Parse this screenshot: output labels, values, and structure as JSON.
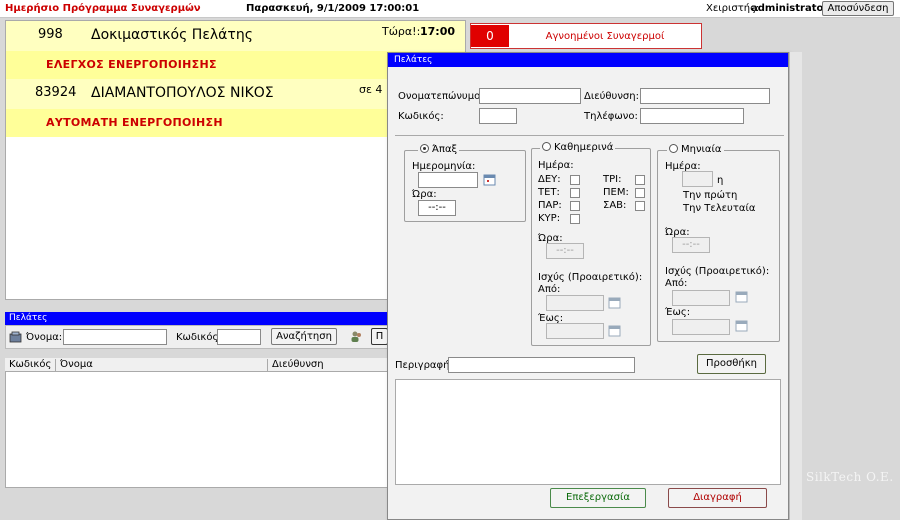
{
  "header": {
    "app_title": "Ημερήσιο Πρόγραμμα Συναγερμών",
    "datetime": "Παρασκευή, 9/1/2009 17:00:01",
    "user_label": "Χειριστής:",
    "user_name": "administrator",
    "logout_label": "Αποσύνδεση"
  },
  "alarms": [
    {
      "code": "998",
      "name": "Δοκιμαστικός Πελάτης",
      "time_label": "Τώρα!:",
      "time_value": "17:00",
      "status": "ΕΛΕΓΧΟΣ ΕΝΕΡΓΟΠΟΙΗΣΗΣ"
    },
    {
      "code": "83924",
      "name": "ΔΙΑΜΑΝΤΟΠΟΥΛΟΣ ΝΙΚΟΣ",
      "time_label": "σε 4",
      "status": "ΑΥΤΟΜΑΤΗ ΕΝΕΡΓΟΠΟΙΗΣΗ"
    }
  ],
  "dismissed": {
    "count": "0",
    "label": "Αγνοημένοι Συναγερμοί"
  },
  "customers_panel": {
    "title": "Πελάτες",
    "name_label": "Όνομα:",
    "code_label": "Κωδικός:",
    "search_label": "Αναζήτηση",
    "extra_button_label": "Π",
    "columns": [
      "Κωδικός",
      "Όνομα",
      "Διεύθυνση"
    ]
  },
  "dialog": {
    "title": "Πελάτες",
    "fullname_label": "Ονοματεπώνυμο:",
    "address_label": "Διεύθυνση:",
    "code_label": "Κωδικός:",
    "phone_label": "Τηλέφωνο:",
    "once": {
      "legend": "Άπαξ",
      "date_label": "Ημερομηνία:",
      "time_label": "Ώρα:",
      "time_value": "--:--"
    },
    "daily": {
      "legend": "Καθημερινά",
      "day_label": "Ημέρα:",
      "days": [
        "ΔΕΥ:",
        "ΤΡΙ:",
        "ΤΕΤ:",
        "ΠΕΜ:",
        "ΠΑΡ:",
        "ΣΑΒ:",
        "ΚΥΡ:"
      ],
      "time_label": "Ώρα:",
      "time_value": "--:--",
      "validity_label": "Ισχύς (Προαιρετικό):",
      "from_label": "Από:",
      "to_label": "Έως:"
    },
    "monthly": {
      "legend": "Μηνιαία",
      "day_label": "Ημέρα:",
      "eta": "η",
      "first_label": "Την πρώτη",
      "last_label": "Την Τελευταία",
      "time_label": "Ώρα:",
      "time_value": "--:--",
      "validity_label": "Ισχύς (Προαιρετικό):",
      "from_label": "Από:",
      "to_label": "Έως:"
    },
    "description_label": "Περιγραφή:",
    "add_label": "Προσθήκη",
    "edit_label": "Επεξεργασία",
    "delete_label": "Διαγραφή"
  },
  "brand": "SilkTech O.E.",
  "colors": {
    "accent_blue": "#0000ff",
    "alarm_red": "#cc0000",
    "alarm_yellow": "#ffff99"
  }
}
